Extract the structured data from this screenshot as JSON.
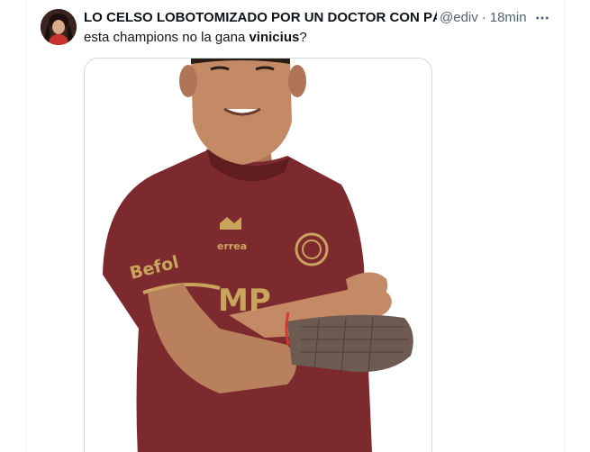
{
  "tweet": {
    "display_name": "LO CELSO LOBOTOMIZADO POR UN DOCTOR CON PÁRKINSON",
    "handle": "@ediv",
    "separator": "·",
    "time": "18min",
    "text_before": "esta champions no la gana ",
    "text_bold": "vinicius",
    "text_after": "?",
    "more_icon": "more-horizontal-icon"
  },
  "media": {
    "jersey_sponsor_sleeve": "Befol",
    "jersey_brand": "errea",
    "jersey_front_partial": "MP",
    "colors": {
      "jersey": "#7d2a2e",
      "trim": "#c9a45c",
      "skin": "#b9805e"
    }
  },
  "colors": {
    "text_primary": "#0f1419",
    "text_secondary": "#536471",
    "border": "#cfd9de"
  }
}
